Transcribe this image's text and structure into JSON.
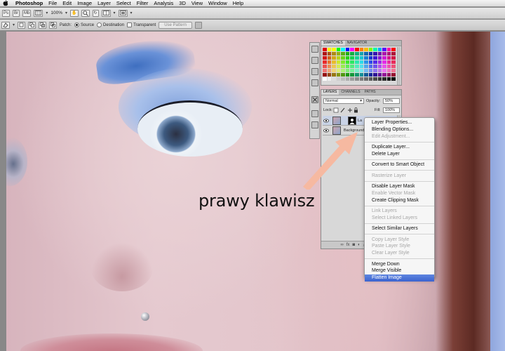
{
  "menubar": {
    "app_name": "Photoshop",
    "items": [
      "File",
      "Edit",
      "Image",
      "Layer",
      "Select",
      "Filter",
      "Analysis",
      "3D",
      "View",
      "Window",
      "Help"
    ]
  },
  "appbar": {
    "icons": [
      "Ps",
      "Br",
      "Mb"
    ],
    "zoom": "100%"
  },
  "options": {
    "patch_label": "Patch:",
    "source_label": "Source",
    "destination_label": "Destination",
    "transparent_label": "Transparent",
    "use_pattern_label": "Use Pattern"
  },
  "panels": {
    "swatches_tab": "SWATCHES",
    "navigator_tab": "NAVIGATOR",
    "layers_tab": "LAYERS",
    "channels_tab": "CHANNELS",
    "paths_tab": "PATHS"
  },
  "layers_panel": {
    "blend_mode": "Normal",
    "opacity_label": "Opacity:",
    "opacity_value": "50%",
    "lock_label": "Lock:",
    "fill_label": "Fill:",
    "fill_value": "100%",
    "layer1_name": "La",
    "layer2_name": "Background"
  },
  "caption": "prawy klawisz",
  "context_menu": {
    "groups": [
      [
        {
          "label": "Layer Properties...",
          "enabled": true
        },
        {
          "label": "Blending Options...",
          "enabled": true
        },
        {
          "label": "Edit Adjustment...",
          "enabled": false
        }
      ],
      [
        {
          "label": "Duplicate Layer...",
          "enabled": true
        },
        {
          "label": "Delete Layer",
          "enabled": true
        }
      ],
      [
        {
          "label": "Convert to Smart Object",
          "enabled": true
        }
      ],
      [
        {
          "label": "Rasterize Layer",
          "enabled": false
        }
      ],
      [
        {
          "label": "Disable Layer Mask",
          "enabled": true
        },
        {
          "label": "Enable Vector Mask",
          "enabled": false
        },
        {
          "label": "Create Clipping Mask",
          "enabled": true
        }
      ],
      [
        {
          "label": "Link Layers",
          "enabled": false
        },
        {
          "label": "Select Linked Layers",
          "enabled": false
        }
      ],
      [
        {
          "label": "Select Similar Layers",
          "enabled": true
        }
      ],
      [
        {
          "label": "Copy Layer Style",
          "enabled": false
        },
        {
          "label": "Paste Layer Style",
          "enabled": false
        },
        {
          "label": "Clear Layer Style",
          "enabled": false
        }
      ],
      [
        {
          "label": "Merge Down",
          "enabled": true
        },
        {
          "label": "Merge Visible",
          "enabled": true
        },
        {
          "label": "Flatten Image",
          "enabled": true,
          "highlighted": true
        }
      ]
    ]
  },
  "colors": {
    "highlight": "#3b63cf",
    "arrow": "#f5b8a0"
  }
}
